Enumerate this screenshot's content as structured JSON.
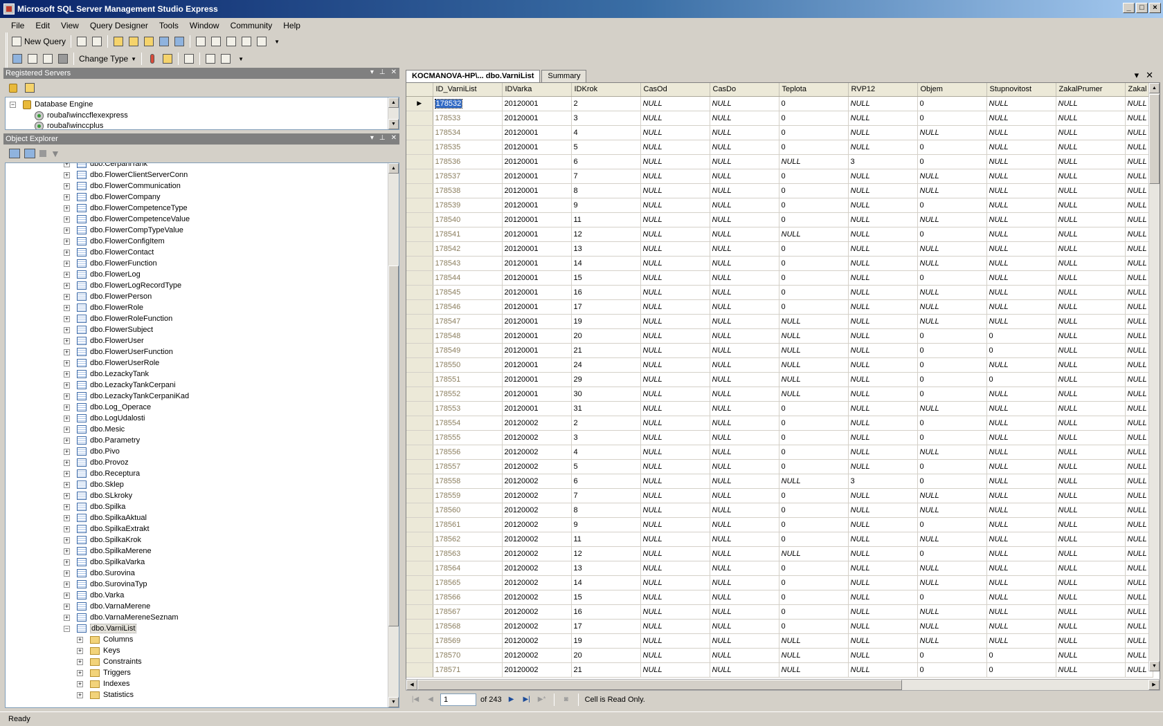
{
  "window": {
    "title": "Microsoft SQL Server Management Studio Express"
  },
  "menu": [
    "File",
    "Edit",
    "View",
    "Query Designer",
    "Tools",
    "Window",
    "Community",
    "Help"
  ],
  "toolbar": {
    "new_query": "New Query",
    "change_type": "Change Type"
  },
  "registered_servers": {
    "title": "Registered Servers",
    "root": "Database Engine",
    "servers": [
      "roubal\\winccflexexpress",
      "roubal\\winccplus"
    ]
  },
  "object_explorer": {
    "title": "Object Explorer",
    "tables": [
      "dbo.CerpaniTank",
      "dbo.FlowerClientServerConn",
      "dbo.FlowerCommunication",
      "dbo.FlowerCompany",
      "dbo.FlowerCompetenceType",
      "dbo.FlowerCompetenceValue",
      "dbo.FlowerCompTypeValue",
      "dbo.FlowerConfigItem",
      "dbo.FlowerContact",
      "dbo.FlowerFunction",
      "dbo.FlowerLog",
      "dbo.FlowerLogRecordType",
      "dbo.FlowerPerson",
      "dbo.FlowerRole",
      "dbo.FlowerRoleFunction",
      "dbo.FlowerSubject",
      "dbo.FlowerUser",
      "dbo.FlowerUserFunction",
      "dbo.FlowerUserRole",
      "dbo.LezackyTank",
      "dbo.LezackyTankCerpani",
      "dbo.LezackyTankCerpaniKad",
      "dbo.Log_Operace",
      "dbo.LogUdalosti",
      "dbo.Mesic",
      "dbo.Parametry",
      "dbo.Pivo",
      "dbo.Provoz",
      "dbo.Receptura",
      "dbo.Sklep",
      "dbo.SLkroky",
      "dbo.Spilka",
      "dbo.SpilkaAktual",
      "dbo.SpilkaExtrakt",
      "dbo.SpilkaKrok",
      "dbo.SpilkaMerene",
      "dbo.SpilkaVarka",
      "dbo.Surovina",
      "dbo.SurovinaTyp",
      "dbo.Varka",
      "dbo.VarnaMerene",
      "dbo.VarnaMereneSeznam"
    ],
    "expanded_table": "dbo.VarniList",
    "folders": [
      "Columns",
      "Keys",
      "Constraints",
      "Triggers",
      "Indexes",
      "Statistics"
    ]
  },
  "document": {
    "tabs": [
      "KOCMANOVA-HP\\... dbo.VarniList",
      "Summary"
    ],
    "columns": [
      "ID_VarniList",
      "IDVarka",
      "IDKrok",
      "CasOd",
      "CasDo",
      "Teplota",
      "RVP12",
      "Objem",
      "Stupnovitost",
      "ZakalPrumer",
      "Zakal"
    ],
    "rows": [
      [
        "178532",
        "20120001",
        "2",
        "NULL",
        "NULL",
        "0",
        "NULL",
        "0",
        "NULL",
        "NULL",
        "NULL"
      ],
      [
        "178533",
        "20120001",
        "3",
        "NULL",
        "NULL",
        "0",
        "NULL",
        "0",
        "NULL",
        "NULL",
        "NULL"
      ],
      [
        "178534",
        "20120001",
        "4",
        "NULL",
        "NULL",
        "0",
        "NULL",
        "NULL",
        "NULL",
        "NULL",
        "NULL"
      ],
      [
        "178535",
        "20120001",
        "5",
        "NULL",
        "NULL",
        "0",
        "NULL",
        "0",
        "NULL",
        "NULL",
        "NULL"
      ],
      [
        "178536",
        "20120001",
        "6",
        "NULL",
        "NULL",
        "NULL",
        "3",
        "0",
        "NULL",
        "NULL",
        "NULL"
      ],
      [
        "178537",
        "20120001",
        "7",
        "NULL",
        "NULL",
        "0",
        "NULL",
        "NULL",
        "NULL",
        "NULL",
        "NULL"
      ],
      [
        "178538",
        "20120001",
        "8",
        "NULL",
        "NULL",
        "0",
        "NULL",
        "NULL",
        "NULL",
        "NULL",
        "NULL"
      ],
      [
        "178539",
        "20120001",
        "9",
        "NULL",
        "NULL",
        "0",
        "NULL",
        "0",
        "NULL",
        "NULL",
        "NULL"
      ],
      [
        "178540",
        "20120001",
        "11",
        "NULL",
        "NULL",
        "0",
        "NULL",
        "NULL",
        "NULL",
        "NULL",
        "NULL"
      ],
      [
        "178541",
        "20120001",
        "12",
        "NULL",
        "NULL",
        "NULL",
        "NULL",
        "0",
        "NULL",
        "NULL",
        "NULL"
      ],
      [
        "178542",
        "20120001",
        "13",
        "NULL",
        "NULL",
        "0",
        "NULL",
        "NULL",
        "NULL",
        "NULL",
        "NULL"
      ],
      [
        "178543",
        "20120001",
        "14",
        "NULL",
        "NULL",
        "0",
        "NULL",
        "NULL",
        "NULL",
        "NULL",
        "NULL"
      ],
      [
        "178544",
        "20120001",
        "15",
        "NULL",
        "NULL",
        "0",
        "NULL",
        "0",
        "NULL",
        "NULL",
        "NULL"
      ],
      [
        "178545",
        "20120001",
        "16",
        "NULL",
        "NULL",
        "0",
        "NULL",
        "NULL",
        "NULL",
        "NULL",
        "NULL"
      ],
      [
        "178546",
        "20120001",
        "17",
        "NULL",
        "NULL",
        "0",
        "NULL",
        "NULL",
        "NULL",
        "NULL",
        "NULL"
      ],
      [
        "178547",
        "20120001",
        "19",
        "NULL",
        "NULL",
        "NULL",
        "NULL",
        "NULL",
        "NULL",
        "NULL",
        "NULL"
      ],
      [
        "178548",
        "20120001",
        "20",
        "NULL",
        "NULL",
        "NULL",
        "NULL",
        "0",
        "0",
        "NULL",
        "NULL"
      ],
      [
        "178549",
        "20120001",
        "21",
        "NULL",
        "NULL",
        "NULL",
        "NULL",
        "0",
        "0",
        "NULL",
        "NULL"
      ],
      [
        "178550",
        "20120001",
        "24",
        "NULL",
        "NULL",
        "NULL",
        "NULL",
        "0",
        "NULL",
        "NULL",
        "NULL"
      ],
      [
        "178551",
        "20120001",
        "29",
        "NULL",
        "NULL",
        "NULL",
        "NULL",
        "0",
        "0",
        "NULL",
        "NULL"
      ],
      [
        "178552",
        "20120001",
        "30",
        "NULL",
        "NULL",
        "NULL",
        "NULL",
        "0",
        "NULL",
        "NULL",
        "NULL"
      ],
      [
        "178553",
        "20120001",
        "31",
        "NULL",
        "NULL",
        "0",
        "NULL",
        "NULL",
        "NULL",
        "NULL",
        "NULL"
      ],
      [
        "178554",
        "20120002",
        "2",
        "NULL",
        "NULL",
        "0",
        "NULL",
        "0",
        "NULL",
        "NULL",
        "NULL"
      ],
      [
        "178555",
        "20120002",
        "3",
        "NULL",
        "NULL",
        "0",
        "NULL",
        "0",
        "NULL",
        "NULL",
        "NULL"
      ],
      [
        "178556",
        "20120002",
        "4",
        "NULL",
        "NULL",
        "0",
        "NULL",
        "NULL",
        "NULL",
        "NULL",
        "NULL"
      ],
      [
        "178557",
        "20120002",
        "5",
        "NULL",
        "NULL",
        "0",
        "NULL",
        "0",
        "NULL",
        "NULL",
        "NULL"
      ],
      [
        "178558",
        "20120002",
        "6",
        "NULL",
        "NULL",
        "NULL",
        "3",
        "0",
        "NULL",
        "NULL",
        "NULL"
      ],
      [
        "178559",
        "20120002",
        "7",
        "NULL",
        "NULL",
        "0",
        "NULL",
        "NULL",
        "NULL",
        "NULL",
        "NULL"
      ],
      [
        "178560",
        "20120002",
        "8",
        "NULL",
        "NULL",
        "0",
        "NULL",
        "NULL",
        "NULL",
        "NULL",
        "NULL"
      ],
      [
        "178561",
        "20120002",
        "9",
        "NULL",
        "NULL",
        "0",
        "NULL",
        "0",
        "NULL",
        "NULL",
        "NULL"
      ],
      [
        "178562",
        "20120002",
        "11",
        "NULL",
        "NULL",
        "0",
        "NULL",
        "NULL",
        "NULL",
        "NULL",
        "NULL"
      ],
      [
        "178563",
        "20120002",
        "12",
        "NULL",
        "NULL",
        "NULL",
        "NULL",
        "0",
        "NULL",
        "NULL",
        "NULL"
      ],
      [
        "178564",
        "20120002",
        "13",
        "NULL",
        "NULL",
        "0",
        "NULL",
        "NULL",
        "NULL",
        "NULL",
        "NULL"
      ],
      [
        "178565",
        "20120002",
        "14",
        "NULL",
        "NULL",
        "0",
        "NULL",
        "NULL",
        "NULL",
        "NULL",
        "NULL"
      ],
      [
        "178566",
        "20120002",
        "15",
        "NULL",
        "NULL",
        "0",
        "NULL",
        "0",
        "NULL",
        "NULL",
        "NULL"
      ],
      [
        "178567",
        "20120002",
        "16",
        "NULL",
        "NULL",
        "0",
        "NULL",
        "NULL",
        "NULL",
        "NULL",
        "NULL"
      ],
      [
        "178568",
        "20120002",
        "17",
        "NULL",
        "NULL",
        "0",
        "NULL",
        "NULL",
        "NULL",
        "NULL",
        "NULL"
      ],
      [
        "178569",
        "20120002",
        "19",
        "NULL",
        "NULL",
        "NULL",
        "NULL",
        "NULL",
        "NULL",
        "NULL",
        "NULL"
      ],
      [
        "178570",
        "20120002",
        "20",
        "NULL",
        "NULL",
        "NULL",
        "NULL",
        "0",
        "0",
        "NULL",
        "NULL"
      ],
      [
        "178571",
        "20120002",
        "21",
        "NULL",
        "NULL",
        "NULL",
        "NULL",
        "0",
        "0",
        "NULL",
        "NULL"
      ]
    ]
  },
  "navigator": {
    "page": "1",
    "of_label": "of 243",
    "message": "Cell is Read Only."
  },
  "status": {
    "text": "Ready"
  }
}
